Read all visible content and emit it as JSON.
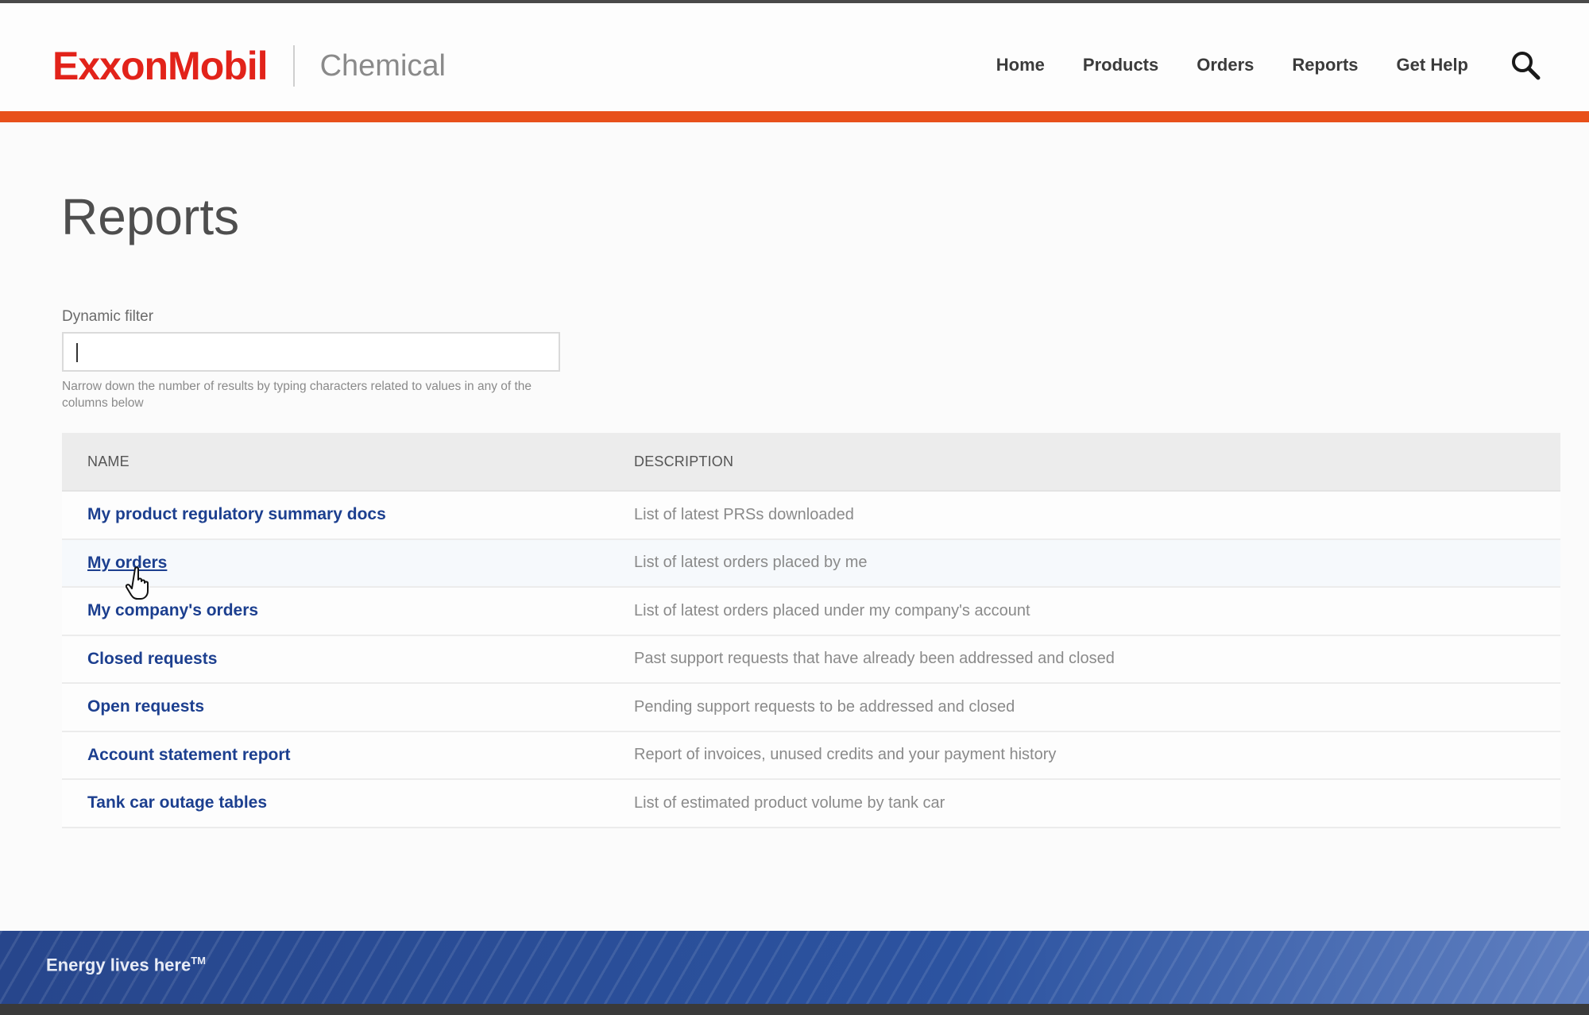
{
  "header": {
    "brand": "ExxonMobil",
    "division": "Chemical",
    "nav": [
      {
        "label": "Home"
      },
      {
        "label": "Products"
      },
      {
        "label": "Orders"
      },
      {
        "label": "Reports"
      },
      {
        "label": "Get Help"
      }
    ]
  },
  "main": {
    "title": "Reports",
    "filter": {
      "label": "Dynamic filter",
      "value": "",
      "help": "Narrow down the number of results by typing characters related to values in any of the columns below"
    },
    "table": {
      "columns": [
        "NAME",
        "DESCRIPTION"
      ],
      "rows": [
        {
          "name": "My product regulatory summary docs",
          "description": "List of latest PRSs downloaded"
        },
        {
          "name": "My orders",
          "description": "List of latest orders placed by me"
        },
        {
          "name": "My company's orders",
          "description": "List of latest orders placed under my company's account"
        },
        {
          "name": "Closed requests",
          "description": "Past support requests that have already been addressed and closed"
        },
        {
          "name": "Open requests",
          "description": "Pending support requests to be addressed and closed"
        },
        {
          "name": "Account statement report",
          "description": "Report of invoices, unused credits and your payment history"
        },
        {
          "name": "Tank car outage tables",
          "description": "List of estimated product volume by tank car"
        }
      ]
    }
  },
  "footer": {
    "tagline": "Energy lives here",
    "trademark": "TM"
  },
  "colors": {
    "brand_red": "#e2231a",
    "accent_orange": "#e8501a",
    "link_blue": "#1c3f8f",
    "footer_blue": "#2b4e97"
  },
  "icons": {
    "search": "search-icon",
    "pointer": "hand-cursor-icon"
  }
}
